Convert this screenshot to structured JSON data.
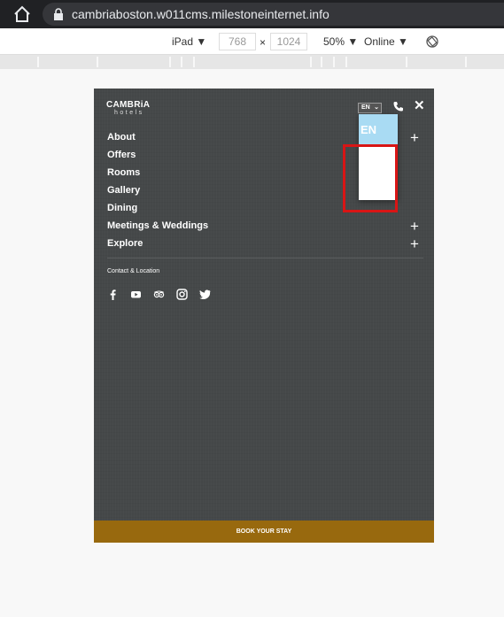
{
  "browser": {
    "url": "cambriaboston.w011cms.milestoneinternet.info"
  },
  "devtools": {
    "device": "iPad",
    "width": "768",
    "times": "×",
    "height": "1024",
    "zoom": "50%",
    "network": "Online"
  },
  "site": {
    "logo_brand": "CAMBRiA",
    "logo_sub": "hotels",
    "language": "EN",
    "language_option": "EN",
    "close": "✕",
    "menu": [
      {
        "label": "About",
        "expandable": true
      },
      {
        "label": "Offers",
        "expandable": false
      },
      {
        "label": "Rooms",
        "expandable": false
      },
      {
        "label": "Gallery",
        "expandable": false
      },
      {
        "label": "Dining",
        "expandable": false
      },
      {
        "label": "Meetings & Weddings",
        "expandable": true
      },
      {
        "label": "Explore",
        "expandable": true
      }
    ],
    "plus": "+",
    "contact": "Contact & Location",
    "social_icons": [
      "facebook-icon",
      "youtube-icon",
      "tripadvisor-icon",
      "instagram-icon",
      "twitter-icon"
    ],
    "book": "BOOK YOUR STAY"
  },
  "colors": {
    "menu_bg": "#454849",
    "book_bg": "#98690e",
    "highlight": "#d81515",
    "dropdown_selected": "#a9dbf3"
  }
}
